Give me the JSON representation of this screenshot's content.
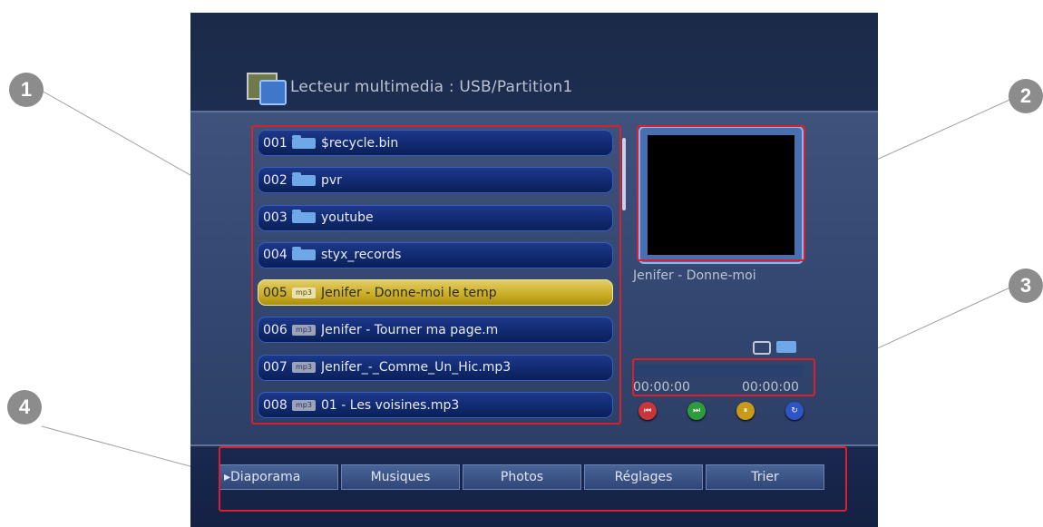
{
  "header": {
    "title": "Lecteur multimedia : USB/Partition1"
  },
  "file_list": [
    {
      "num": "001",
      "type": "folder",
      "name": "$recycle.bin"
    },
    {
      "num": "002",
      "type": "folder",
      "name": "pvr"
    },
    {
      "num": "003",
      "type": "folder",
      "name": "youtube"
    },
    {
      "num": "004",
      "type": "folder",
      "name": "styx_records"
    },
    {
      "num": "005",
      "type": "mp3",
      "name": "Jenifer - Donne-moi le temp",
      "selected": true
    },
    {
      "num": "006",
      "type": "mp3",
      "name": "Jenifer - Tourner ma page.m"
    },
    {
      "num": "007",
      "type": "mp3",
      "name": "Jenifer_-_Comme_Un_Hic.mp3"
    },
    {
      "num": "008",
      "type": "mp3",
      "name": "01 - Les voisines.mp3"
    }
  ],
  "file_type_badge": "mp3",
  "player": {
    "now_playing": "Jenifer - Donne-moi",
    "time_start": "00:00:00",
    "time_end": "00:00:00",
    "progress_fraction": 0,
    "controls": [
      {
        "name": "previous",
        "color": "#c8353b",
        "glyph": "⏮"
      },
      {
        "name": "next",
        "color": "#2f9c3c",
        "glyph": "⏭"
      },
      {
        "name": "pause",
        "color": "#c79a1c",
        "glyph": "⏸"
      },
      {
        "name": "repeat",
        "color": "#2d55c8",
        "glyph": "↻"
      }
    ]
  },
  "bottom_menu": {
    "buttons": [
      {
        "label": "▸Diaporama"
      },
      {
        "label": "Musiques"
      },
      {
        "label": "Photos"
      },
      {
        "label": "Réglages"
      },
      {
        "label": "Trier"
      }
    ]
  },
  "callouts": [
    "1",
    "2",
    "3",
    "4"
  ],
  "colors": {
    "highlight": "#d8212e",
    "selected_row": "#d9c040",
    "row": "#12307a",
    "background": "#1f3158"
  }
}
